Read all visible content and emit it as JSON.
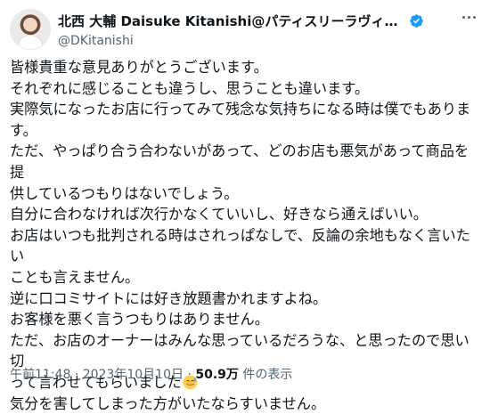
{
  "author": {
    "display_name": "北西 大輔 Daisuke Kitanishi@パティスリーラヴィアンレーヴ",
    "handle": "@DKitanishi",
    "verified_badge_icon": "verified-badge-icon",
    "avatar_icon": "avatar"
  },
  "more_icon": "more-options-icon",
  "tweet": {
    "lines": [
      "皆様貴重な意見ありがとうございます。",
      "それぞれに感じることも違うし、思うことも違います。",
      "実際気になったお店に行ってみて残念な気持ちになる時は僕でもありま",
      "す。",
      "ただ、やっぱり合う合わないがあって、どのお店も悪気があって商品を提",
      "供しているつもりはないでしょう。",
      "自分に合わなければ次行かなくていいし、好きなら通えばいい。",
      "お店はいつも批判される時はされっぱなしで、反論の余地もなく言いたい",
      "ことも言えません。",
      "逆に口コミサイトには好き放題書かれますよね。",
      "お客様を悪く言うつもりはありません。",
      "ただ、お店のオーナーはみんな思っているだろうな、と思ったので思い切",
      "って言わせてもらいました",
      "気分を害してしまった方がいたならすいません。"
    ],
    "emoji_icon": "sweat-smile-emoji-icon"
  },
  "meta": {
    "time": "午前11:48",
    "separator": "·",
    "date": "2023年10月10日",
    "views_count": "50.9万",
    "views_label": "件の表示"
  },
  "colors": {
    "text": "#0f1419",
    "secondary": "#536471",
    "verified": "#1d9bf0"
  }
}
